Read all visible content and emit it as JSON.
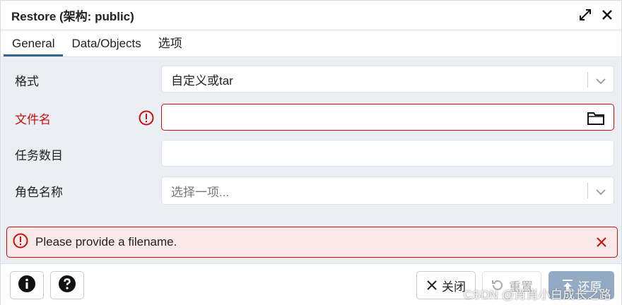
{
  "dialog": {
    "title": "Restore (架构: public)"
  },
  "tabs": [
    {
      "label": "General",
      "active": true
    },
    {
      "label": "Data/Objects",
      "active": false
    },
    {
      "label": "选项",
      "active": false
    }
  ],
  "form": {
    "format": {
      "label": "格式",
      "value": "自定义或tar"
    },
    "filename": {
      "label": "文件名",
      "value": ""
    },
    "jobs": {
      "label": "任务数目",
      "value": ""
    },
    "role": {
      "label": "角色名称",
      "placeholder": "选择一项..."
    }
  },
  "alert": {
    "message": "Please provide a filename."
  },
  "footer": {
    "close_label": "关闭",
    "reset_label": "重置",
    "restore_label": "还原"
  },
  "watermark": "CSDN @肖肖小白成长之路",
  "colors": {
    "accent": "#326690",
    "error": "#ce0e0e",
    "body_bg": "#ebeef3",
    "alert_bg": "#fbe9ea",
    "primary_btn": "#93aac4"
  }
}
